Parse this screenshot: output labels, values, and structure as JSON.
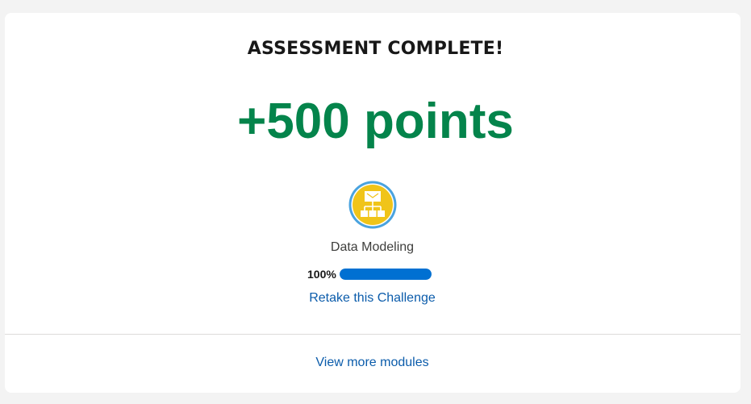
{
  "result": {
    "title": "ASSESSMENT COMPLETE!",
    "points": "+500 points"
  },
  "module": {
    "name": "Data Modeling",
    "badge_icon": "hierarchy-icon",
    "progress_label": "100%",
    "progress_value": 1.0,
    "retake_label": "Retake this Challenge"
  },
  "footer": {
    "view_more_label": "View more modules"
  },
  "colors": {
    "points": "#04844b",
    "badge_fill": "#f0c419",
    "badge_ring": "#4aa3df",
    "progress_fill": "#0070d2",
    "link": "#0b5cab"
  }
}
